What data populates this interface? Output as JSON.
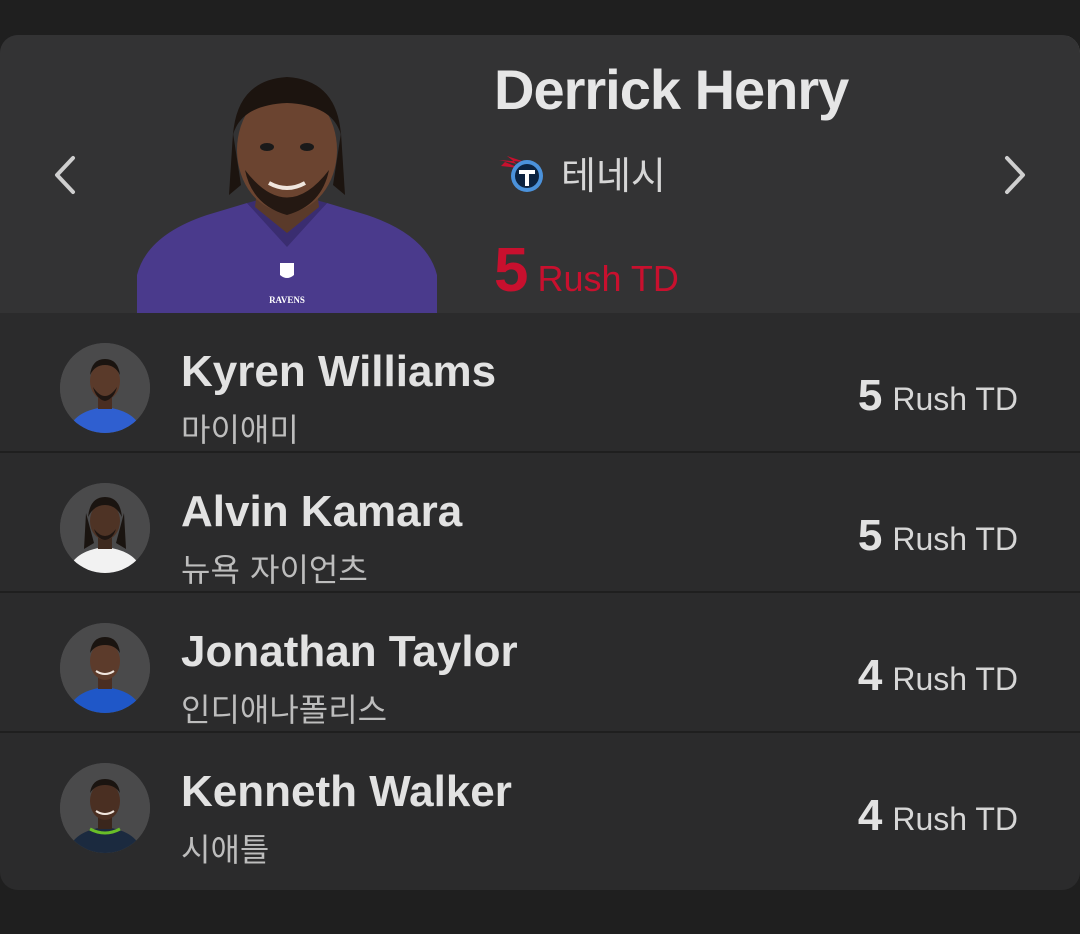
{
  "featured": {
    "name": "Derrick Henry",
    "team": "테네시",
    "stat_value": "5",
    "stat_unit": "Rush TD",
    "jersey_text": "RAVENS",
    "team_logo_icon": "titans-logo-icon",
    "accent_color": "#c8102e",
    "jersey_color": "#4a3a8c"
  },
  "navigation": {
    "prev_icon": "chevron-left-icon",
    "next_icon": "chevron-right-icon"
  },
  "leaders": [
    {
      "name": "Kyren Williams",
      "team": "마이애미",
      "stat_value": "5",
      "stat_unit": "Rush TD",
      "jersey_color": "#2f5fd0"
    },
    {
      "name": "Alvin Kamara",
      "team": "뉴욕 자이언츠",
      "stat_value": "5",
      "stat_unit": "Rush TD",
      "jersey_color": "#f2f2f2"
    },
    {
      "name": "Jonathan Taylor",
      "team": "인디애나폴리스",
      "stat_value": "4",
      "stat_unit": "Rush TD",
      "jersey_color": "#1f57c8"
    },
    {
      "name": "Kenneth Walker",
      "team": "시애틀",
      "stat_value": "4",
      "stat_unit": "Rush TD",
      "jersey_color": "#1b2a3f"
    }
  ]
}
